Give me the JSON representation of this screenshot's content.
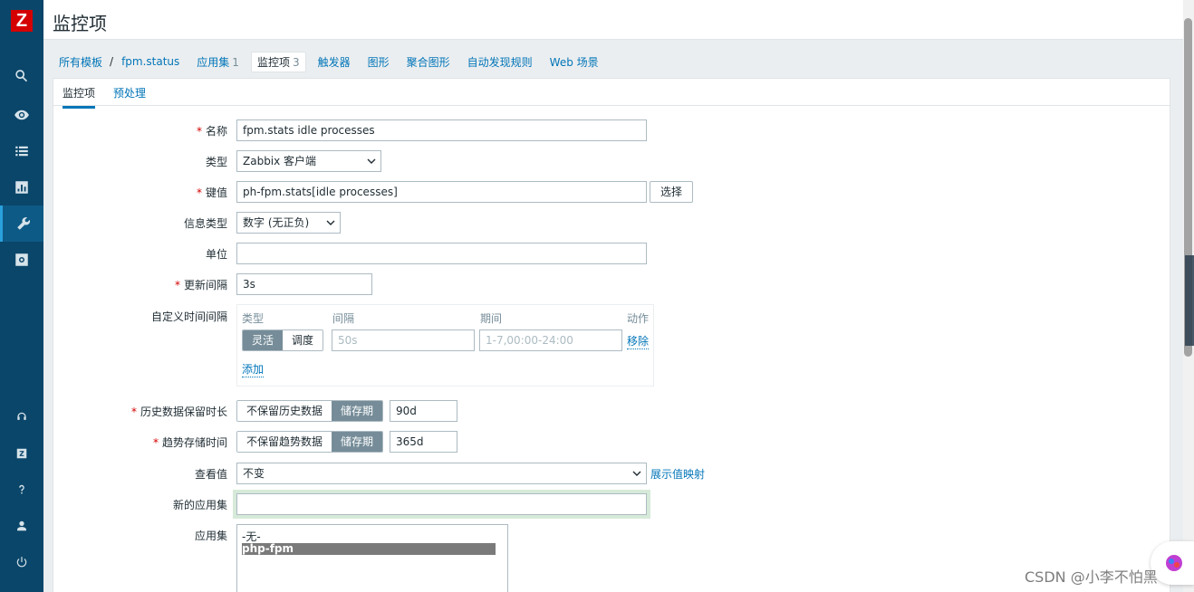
{
  "app": {
    "logo_letter": "Z",
    "page_title": "监控项"
  },
  "sidebar": {
    "icons": [
      "search-icon",
      "eye-icon",
      "list-icon",
      "chart-icon",
      "wrench-icon",
      "gear-icon",
      "headset-icon",
      "zabbix-share-icon",
      "help-icon",
      "user-icon",
      "power-icon"
    ]
  },
  "nav": {
    "all_templates": "所有模板",
    "separator": "/",
    "template": "fpm.status",
    "applications": "应用集",
    "applications_count": "1",
    "items": "监控项",
    "items_count": "3",
    "triggers": "触发器",
    "graphs": "图形",
    "screens": "聚合图形",
    "discovery": "自动发现规则",
    "web": "Web 场景"
  },
  "tabs": {
    "item": "监控项",
    "preprocessing": "预处理"
  },
  "form": {
    "name_label": "名称",
    "name_value": "fpm.stats idle processes",
    "type_label": "类型",
    "type_value": "Zabbix 客户端",
    "key_label": "键值",
    "key_value": "ph-fpm.stats[idle processes]",
    "select_button": "选择",
    "info_type_label": "信息类型",
    "info_type_value": "数字 (无正负)",
    "units_label": "单位",
    "units_value": "",
    "interval_label": "更新间隔",
    "interval_value": "3s",
    "custom_interval_label": "自定义时间间隔",
    "custom": {
      "col_type": "类型",
      "col_interval": "间隔",
      "col_period": "期间",
      "col_action": "动作",
      "flexible": "灵活",
      "scheduling": "调度",
      "interval_placeholder": "50s",
      "period_placeholder": "1-7,00:00-24:00",
      "remove": "移除",
      "add": "添加"
    },
    "history_label": "历史数据保留时长",
    "history_no_keep": "不保留历史数据",
    "history_storage": "储存期",
    "history_value": "90d",
    "trends_label": "趋势存储时间",
    "trends_no_keep": "不保留趋势数据",
    "trends_storage": "储存期",
    "trends_value": "365d",
    "show_value_label": "查看值",
    "show_value_value": "不变",
    "show_value_link": "展示值映射",
    "new_app_label": "新的应用集",
    "new_app_value": "",
    "apps_label": "应用集",
    "apps_options": [
      "-无-",
      "php-fpm"
    ]
  },
  "watermark": "CSDN @小李不怕黑"
}
